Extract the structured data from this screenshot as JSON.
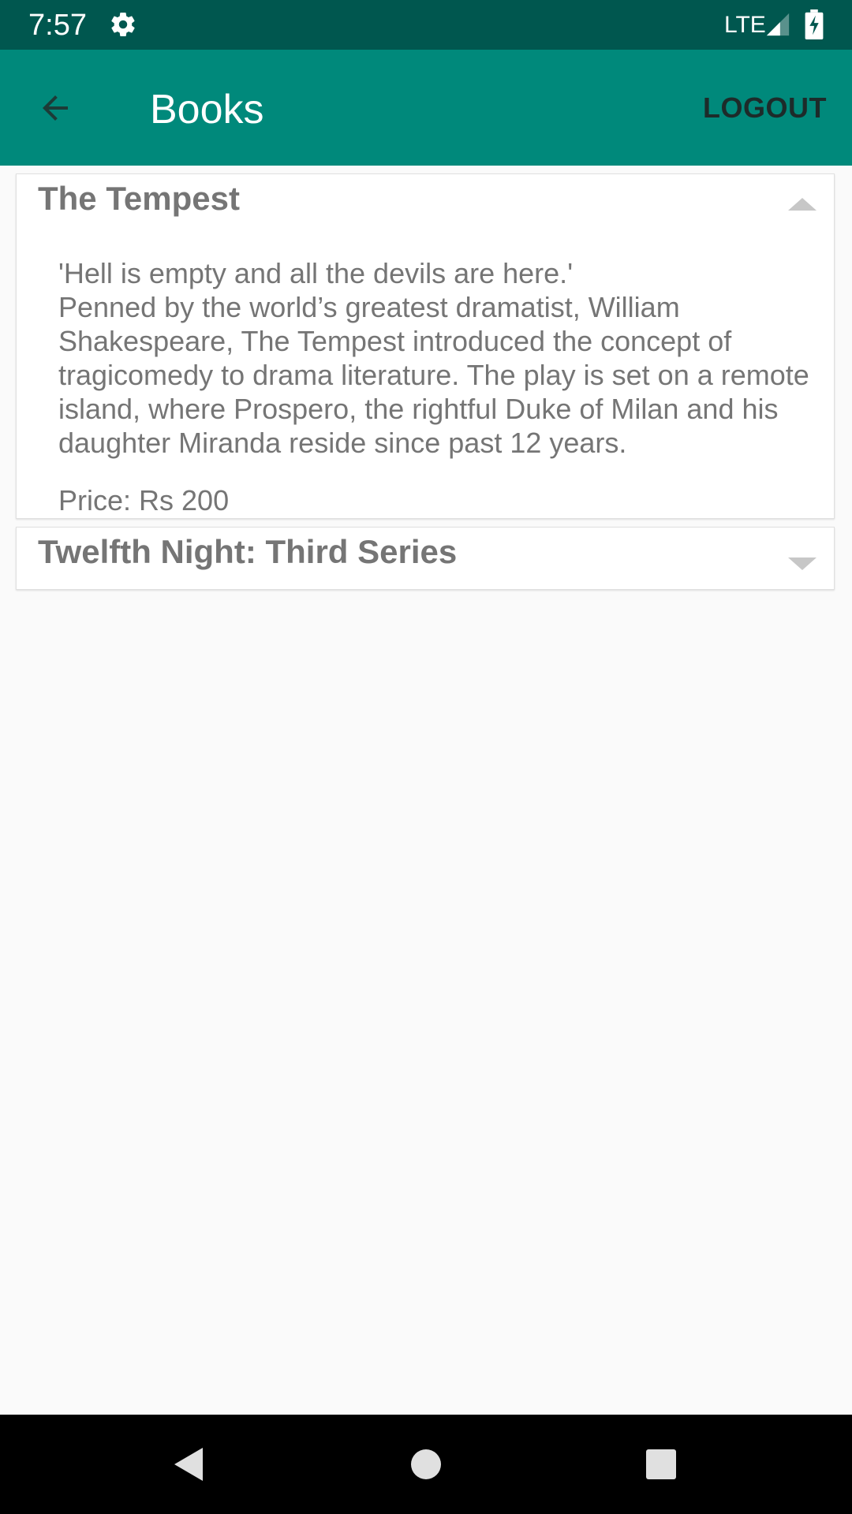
{
  "status_bar": {
    "time": "7:57",
    "network": "LTE",
    "icons": [
      "settings-gear-icon",
      "signal-icon",
      "battery-charging-icon"
    ]
  },
  "app_bar": {
    "title": "Books",
    "logout_label": "LOGOUT",
    "back_icon": "arrow-back-icon"
  },
  "books": [
    {
      "title": "The Tempest",
      "expanded": true,
      "quote": "'Hell is empty and all the devils are here.'",
      "description": "Penned by the world’s greatest dramatist, William Shakespeare, The Tempest introduced the concept of tragicomedy to drama literature. The play is set on a remote island, where Prospero, the rightful Duke of Milan and his daughter Miranda reside since past 12 years.",
      "price": "Price: Rs 200"
    },
    {
      "title": "Twelfth Night: Third Series",
      "expanded": false
    }
  ],
  "nav_bar": {
    "icons": [
      "nav-back-icon",
      "nav-home-icon",
      "nav-recents-icon"
    ]
  },
  "colors": {
    "status_bar": "#00574f",
    "app_bar": "#00897b",
    "background": "#fafafa",
    "card_text": "#757575",
    "toggle": "#c7c7c7"
  }
}
